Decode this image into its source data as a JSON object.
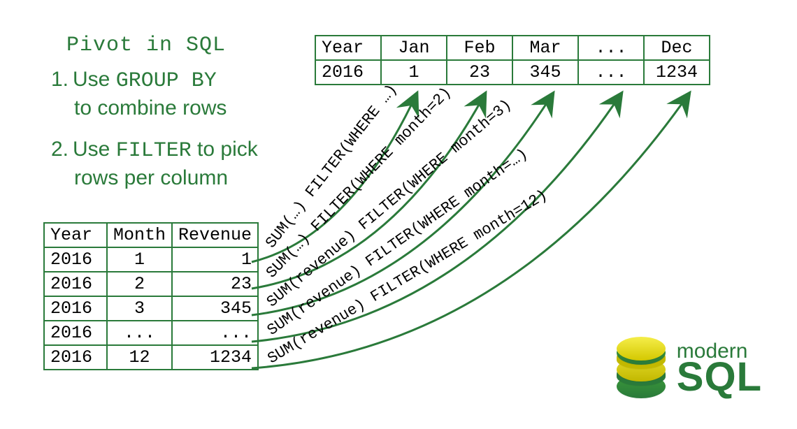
{
  "title": "Pivot in SQL",
  "steps": [
    {
      "num": "1.",
      "pre": "Use ",
      "kw": "GROUP BY",
      "post": "",
      "line2": "to combine rows"
    },
    {
      "num": "2.",
      "pre": "Use ",
      "kw": "FILTER",
      "post": " to pick",
      "line2": "rows per column"
    }
  ],
  "source_table": {
    "headers": [
      "Year",
      "Month",
      "Revenue"
    ],
    "rows": [
      [
        "2016",
        "1",
        "1"
      ],
      [
        "2016",
        "2",
        "23"
      ],
      [
        "2016",
        "3",
        "345"
      ],
      [
        "2016",
        "...",
        "..."
      ],
      [
        "2016",
        "12",
        "1234"
      ]
    ]
  },
  "pivot_table": {
    "headers": [
      "Year",
      "Jan",
      "Feb",
      "Mar",
      "...",
      "Dec"
    ],
    "rows": [
      [
        "2016",
        "1",
        "23",
        "345",
        "...",
        "1234"
      ]
    ]
  },
  "arrow_labels": [
    "SUM(…) FILTER(WHERE …)",
    "SUM(…) FILTER(WHERE month=2)",
    "SUM(revenue) FILTER(WHERE month=3)",
    "SUM(revenue) FILTER(WHERE month=…)",
    "SUM(revenue) FILTER(WHERE month=12)"
  ],
  "logo": {
    "top": "modern",
    "bottom": "SQL"
  },
  "colors": {
    "green": "#2a7a3a",
    "yellow": "#d4c800"
  }
}
